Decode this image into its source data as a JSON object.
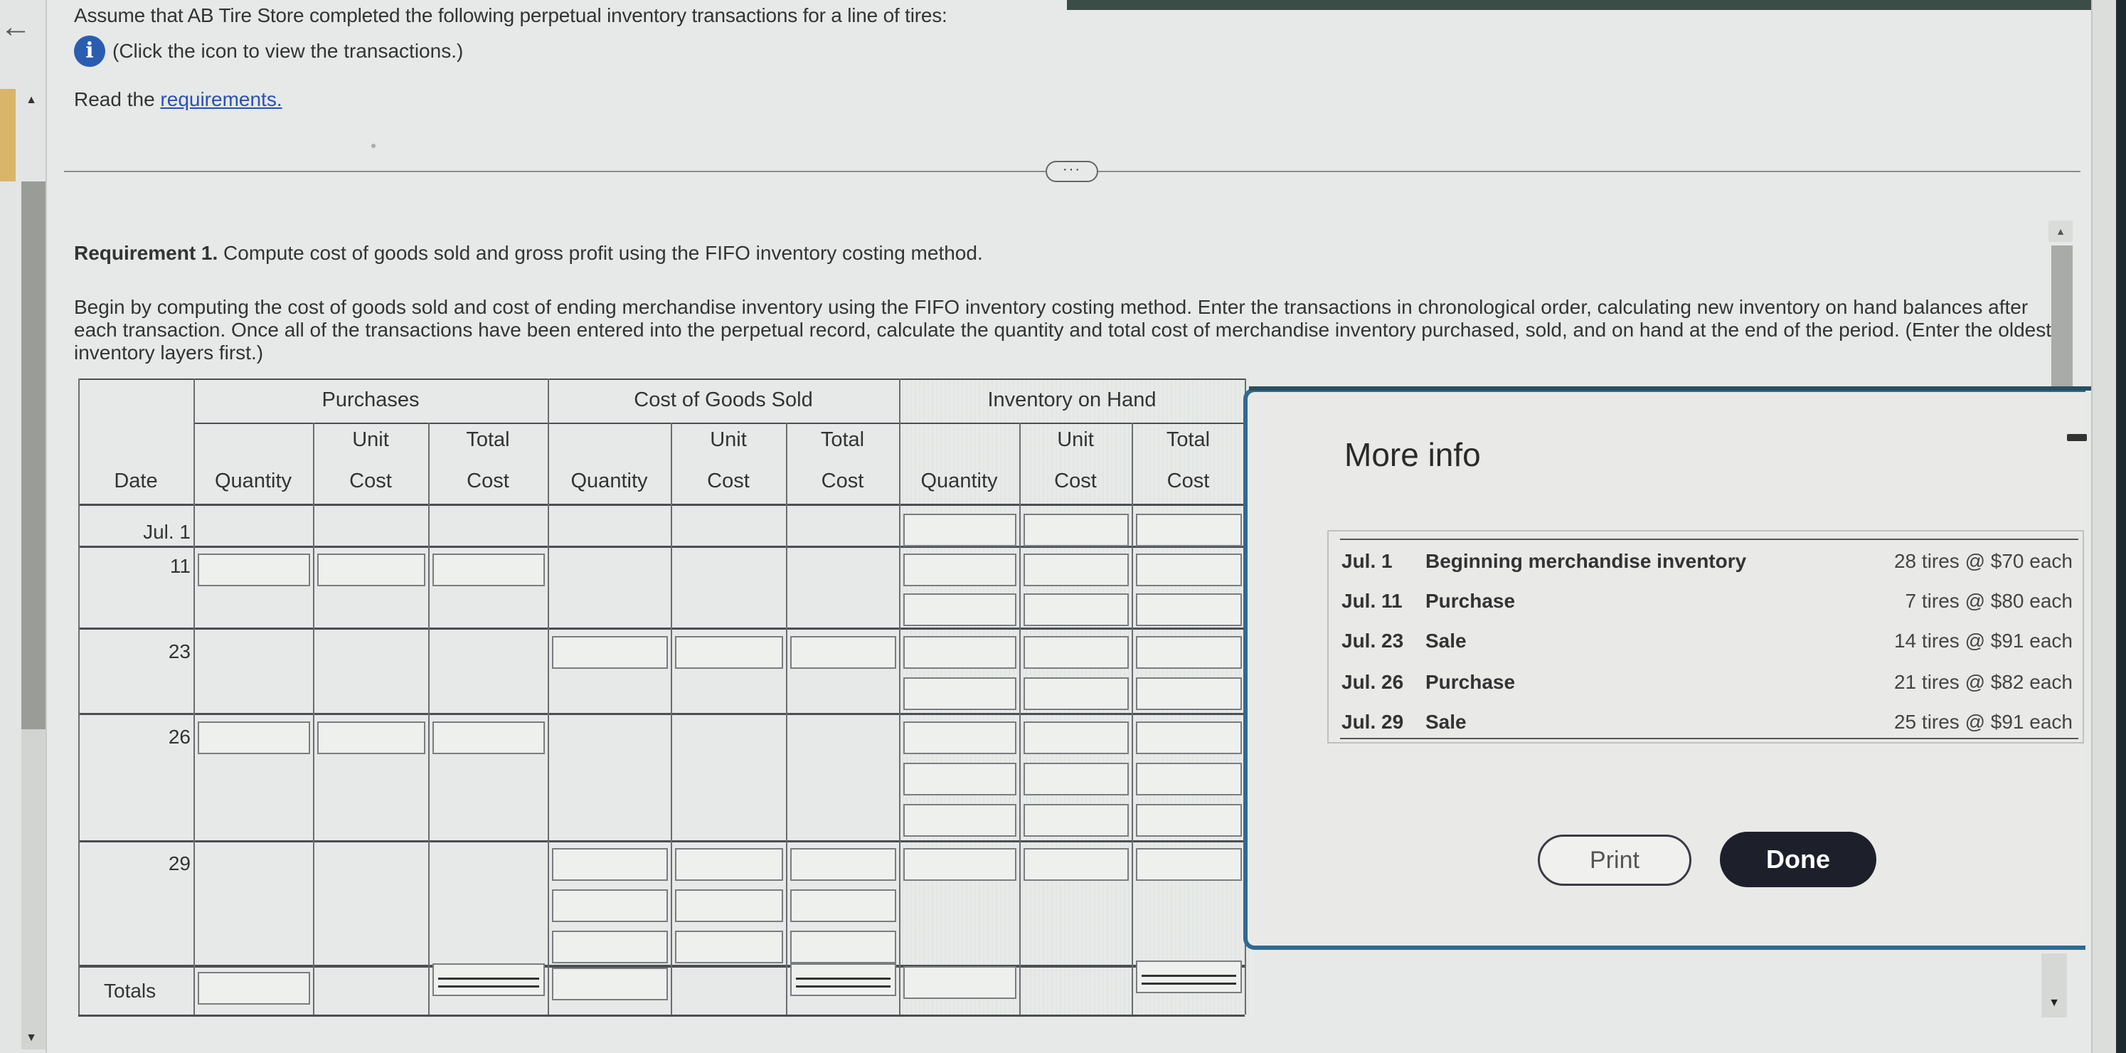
{
  "header": {
    "intro": "Assume that AB Tire Store completed the following perpetual inventory transactions for a line of tires:",
    "info_text": "(Click the icon to view the transactions.)",
    "info_icon": "info-icon",
    "read_prefix": "Read the ",
    "read_link": "requirements."
  },
  "divider": {
    "handle_label": "···"
  },
  "requirement": {
    "title_bold": "Requirement 1.",
    "title_rest": " Compute cost of goods sold and gross profit using the FIFO inventory costing method.",
    "body": "Begin by computing the cost of goods sold and cost of ending merchandise inventory using the FIFO inventory costing method. Enter the transactions in chronological order, calculating new inventory on hand balances after each transaction. Once all of the transactions have been entered into the perpetual record, calculate the quantity and total cost of merchandise inventory purchased, sold, and on hand at the end of the period. (Enter the oldest inventory layers first.)"
  },
  "table": {
    "groups": [
      "Purchases",
      "Cost of Goods Sold",
      "Inventory on Hand"
    ],
    "date_header": "Date",
    "sub_headers": [
      {
        "line1": "",
        "line2": "Quantity"
      },
      {
        "line1": "Unit",
        "line2": "Cost"
      },
      {
        "line1": "Total",
        "line2": "Cost"
      },
      {
        "line1": "",
        "line2": "Quantity"
      },
      {
        "line1": "Unit",
        "line2": "Cost"
      },
      {
        "line1": "Total",
        "line2": "Cost"
      },
      {
        "line1": "",
        "line2": "Quantity"
      },
      {
        "line1": "Unit",
        "line2": "Cost"
      },
      {
        "line1": "Total",
        "line2": "Cost"
      }
    ],
    "rows": [
      {
        "date": "Jul. 1"
      },
      {
        "date": "11"
      },
      {
        "date": "23"
      },
      {
        "date": "26"
      },
      {
        "date": "29"
      }
    ],
    "totals_label": "Totals"
  },
  "modal": {
    "title": "More info",
    "transactions": [
      {
        "date": "Jul. 1",
        "description": "Beginning merchandise inventory",
        "detail": "28 tires @ $70 each"
      },
      {
        "date": "Jul. 11",
        "description": "Purchase",
        "detail": "7 tires @ $80 each"
      },
      {
        "date": "Jul. 23",
        "description": "Sale",
        "detail": "14 tires @ $91 each"
      },
      {
        "date": "Jul. 26",
        "description": "Purchase",
        "detail": "21 tires @ $82 each"
      },
      {
        "date": "Jul. 29",
        "description": "Sale",
        "detail": "25 tires @ $91 each"
      }
    ],
    "print_label": "Print",
    "done_label": "Done"
  },
  "nav": {
    "back_icon": "←",
    "scroll_up": "▲",
    "scroll_down": "▼"
  }
}
